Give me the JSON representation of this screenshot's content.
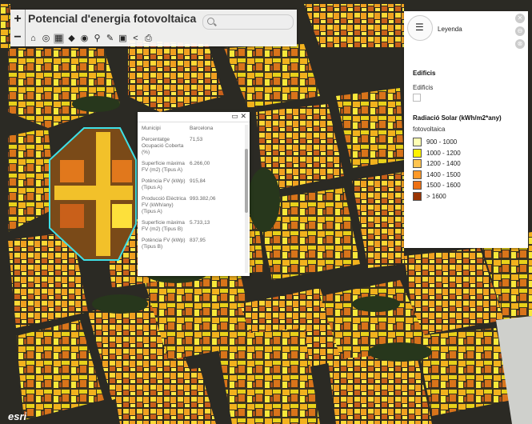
{
  "app": {
    "title": "Potencial d'energia fotovoltaica",
    "zoom_in_label": "+",
    "zoom_out_label": "−",
    "attribution": "esri"
  },
  "toolbar": {
    "tools": [
      {
        "name": "home-icon",
        "glyph": "⌂"
      },
      {
        "name": "layers-icon",
        "glyph": "◎"
      },
      {
        "name": "table-icon",
        "glyph": "▦"
      },
      {
        "name": "basemap-icon",
        "glyph": "◆"
      },
      {
        "name": "globe-icon",
        "glyph": "◉"
      },
      {
        "name": "measure-icon",
        "glyph": "⚲"
      },
      {
        "name": "draw-icon",
        "glyph": "✎"
      },
      {
        "name": "bookmark-icon",
        "glyph": "▣"
      },
      {
        "name": "share-icon",
        "glyph": "<"
      },
      {
        "name": "print-icon",
        "glyph": "⎙"
      }
    ]
  },
  "popup": {
    "rows": [
      {
        "k": "Municipi",
        "v": "Barcelona"
      },
      {
        "k": "Percentatge Ocupació Coberta (%)",
        "v": "71,53"
      },
      {
        "k": "Superfície màxima FV (m2) (Tipus A)",
        "v": "6.266,00"
      },
      {
        "k": "Potència FV (kWp) (Tipus A)",
        "v": "915,84"
      },
      {
        "k": "Producció Elèctrica FV (kWh/any) (Tipus A)",
        "v": "993.382,06"
      },
      {
        "k": "Superfície màxima FV (m2) (Tipus B)",
        "v": "5.733,13"
      },
      {
        "k": "Potència FV (kWp) (Tipus B)",
        "v": "837,95"
      }
    ]
  },
  "legend": {
    "title": "Leyenda",
    "section1_title": "Edificis",
    "section1_item": "Edificis",
    "section2_title": "Radiació Solar (kWh/m2*any)",
    "section2_sub": "fotovoltaica",
    "classes": [
      {
        "label": "900 - 1000",
        "color": "#ffffb2"
      },
      {
        "label": "1000 - 1200",
        "color": "#fff200"
      },
      {
        "label": "1200 - 1400",
        "color": "#fec44f"
      },
      {
        "label": "1400 - 1500",
        "color": "#fe9929"
      },
      {
        "label": "1500 - 1600",
        "color": "#ec7014"
      },
      {
        "label": "> 1600",
        "color": "#993404"
      }
    ]
  }
}
